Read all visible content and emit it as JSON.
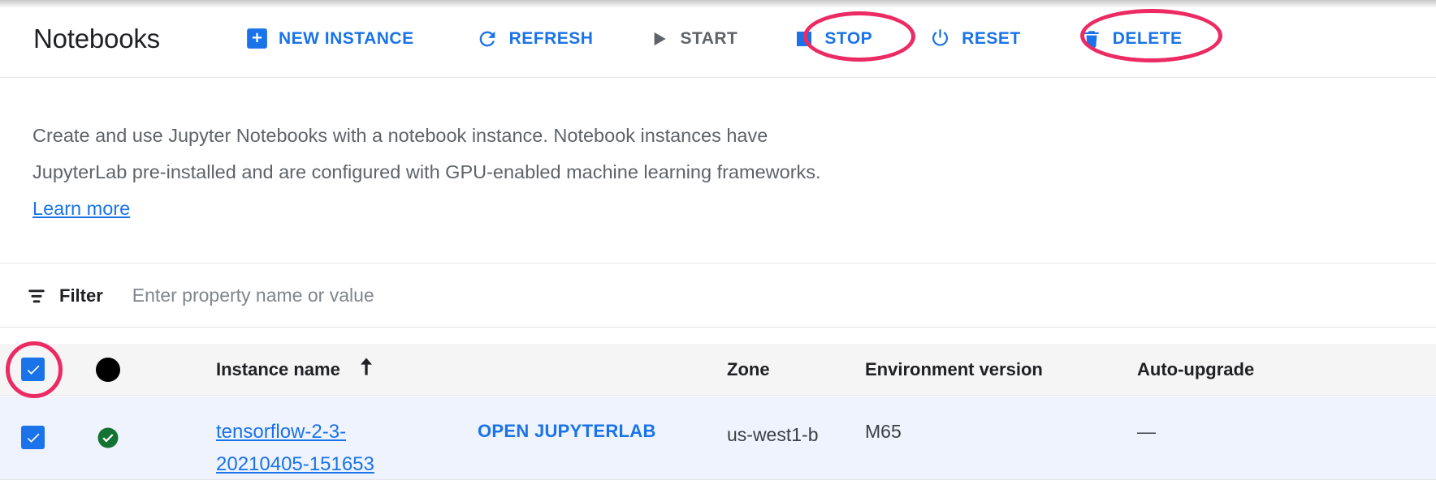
{
  "header": {
    "title": "Notebooks",
    "buttons": [
      {
        "label": "NEW INSTANCE",
        "icon": "plus-box-icon",
        "enabled": true,
        "color": "#1a73e8"
      },
      {
        "label": "REFRESH",
        "icon": "refresh-icon",
        "enabled": true,
        "color": "#1a73e8"
      },
      {
        "label": "START",
        "icon": "play-icon",
        "enabled": false,
        "color": "#5f6368"
      },
      {
        "label": "STOP",
        "icon": "stop-square-icon",
        "enabled": true,
        "color": "#1a73e8"
      },
      {
        "label": "RESET",
        "icon": "power-icon",
        "enabled": true,
        "color": "#1a73e8"
      },
      {
        "label": "DELETE",
        "icon": "trash-icon",
        "enabled": true,
        "color": "#1a73e8"
      }
    ]
  },
  "description": {
    "paragraph": "Create and use Jupyter Notebooks with a notebook instance. Notebook instances have JupyterLab pre-installed and are configured with GPU-enabled machine learning frameworks. ",
    "link_label": "Learn more"
  },
  "filter": {
    "icon": "filter-icon",
    "label": "Filter",
    "placeholder": "Enter property name or value",
    "value": ""
  },
  "table": {
    "columns": [
      {
        "key": "select",
        "label": ""
      },
      {
        "key": "status",
        "label": ""
      },
      {
        "key": "name",
        "label": "Instance name",
        "sorted": "asc",
        "sort_icon": "arrow-up-icon"
      },
      {
        "key": "open",
        "label": ""
      },
      {
        "key": "zone",
        "label": "Zone"
      },
      {
        "key": "env",
        "label": "Environment version"
      },
      {
        "key": "auto",
        "label": "Auto-upgrade"
      }
    ],
    "header_select_all": {
      "checked": true
    },
    "header_status_icon": "circle-filled-icon",
    "rows": [
      {
        "selected": true,
        "status_icon": "check-circle-green-icon",
        "name": "tensorflow-2-3-20210405-151653",
        "open_label": "OPEN JUPYTERLAB",
        "zone": "us-west1-b",
        "env": "M65",
        "auto_upgrade": "—"
      }
    ]
  },
  "annotations": {
    "color": "#ec2a63",
    "items": [
      {
        "name": "stop-button-highlight",
        "target": "STOP"
      },
      {
        "name": "delete-button-highlight",
        "target": "DELETE"
      },
      {
        "name": "row-checkbox-highlight",
        "target": "row select checkbox"
      }
    ]
  }
}
